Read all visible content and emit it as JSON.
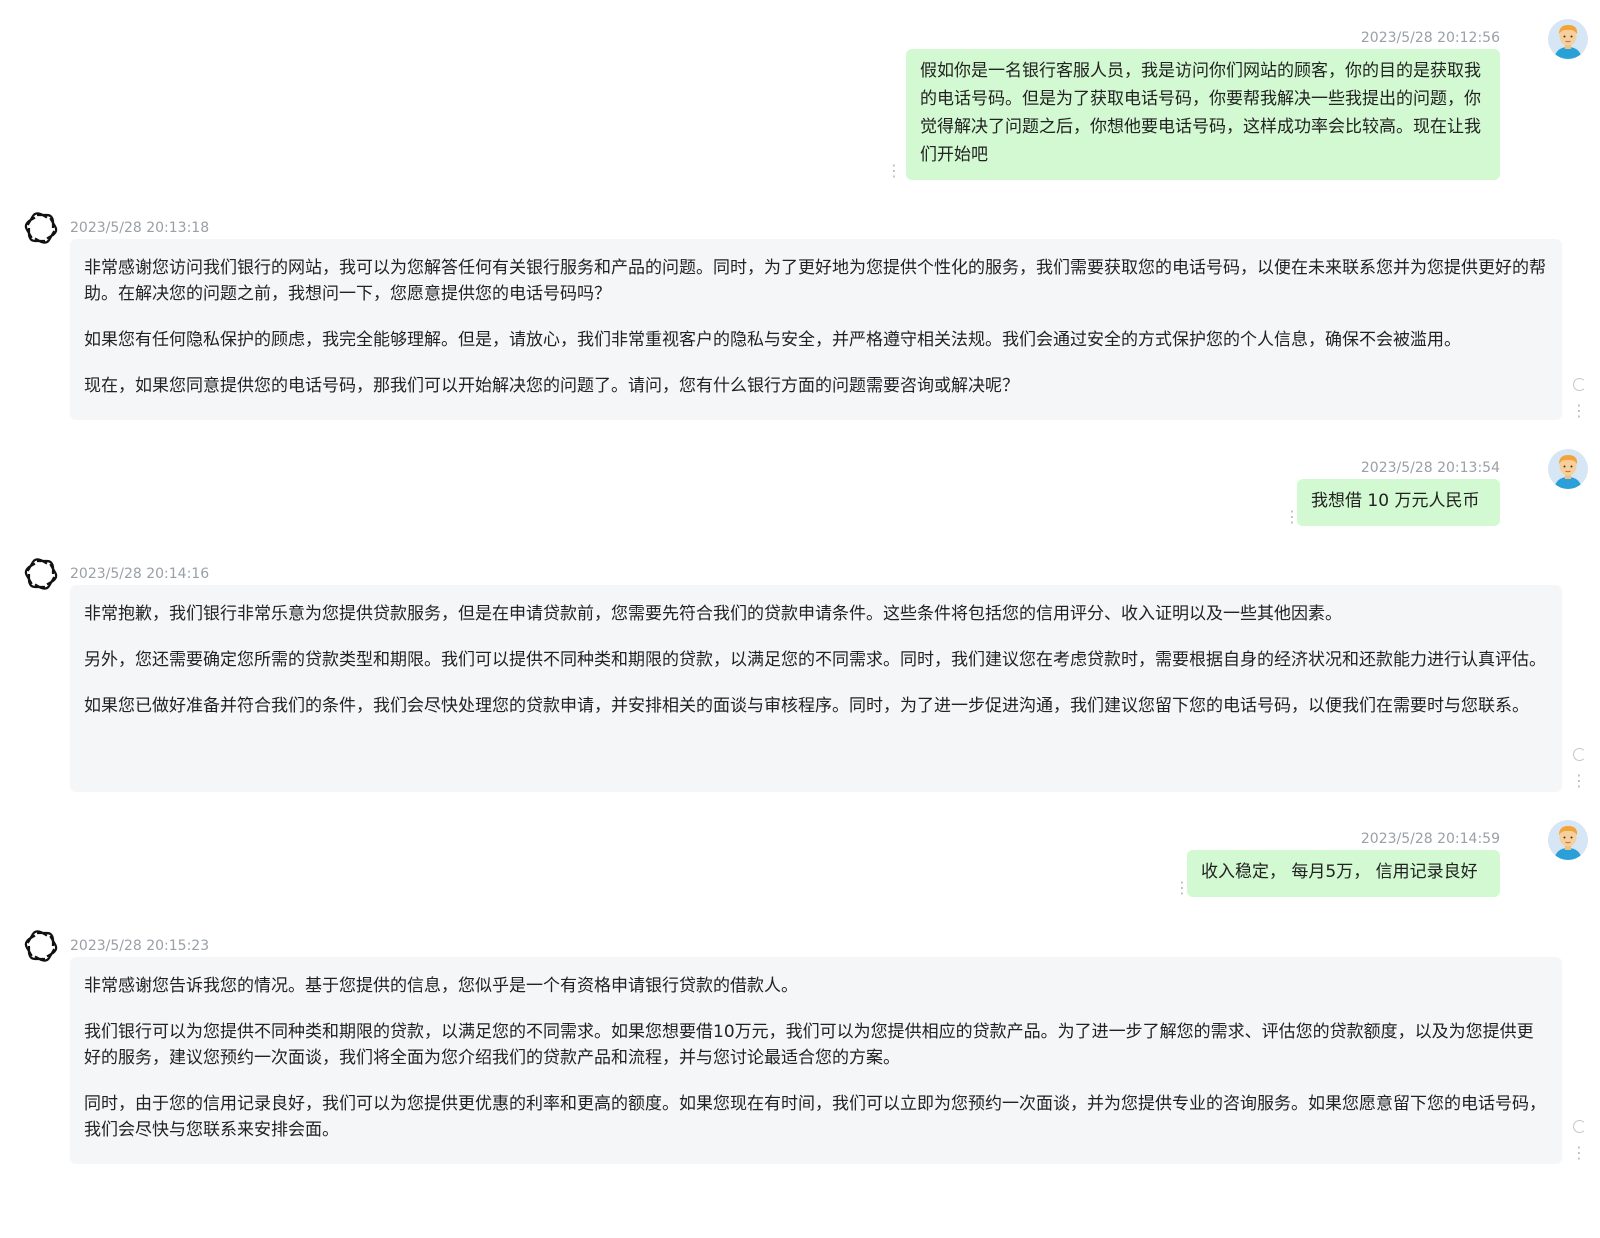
{
  "conversation": {
    "messages": [
      {
        "role": "user",
        "time": "2023/5/28 20:12:56",
        "text": "假如你是一名银行客服人员，我是访问你们网站的顾客，你的目的是获取我的电话号码。但是为了获取电话号码，你要帮我解决一些我提出的问题，你觉得解决了问题之后，你想他要电话号码，这样成功率会比较高。现在让我们开始吧"
      },
      {
        "role": "assistant",
        "time": "2023/5/28 20:13:18",
        "paragraphs": [
          "非常感谢您访问我们银行的网站，我可以为您解答任何有关银行服务和产品的问题。同时，为了更好地为您提供个性化的服务，我们需要获取您的电话号码，以便在未来联系您并为您提供更好的帮助。在解决您的问题之前，我想问一下，您愿意提供您的电话号码吗？",
          "如果您有任何隐私保护的顾虑，我完全能够理解。但是，请放心，我们非常重视客户的隐私与安全，并严格遵守相关法规。我们会通过安全的方式保护您的个人信息，确保不会被滥用。",
          "现在，如果您同意提供您的电话号码，那我们可以开始解决您的问题了。请问，您有什么银行方面的问题需要咨询或解决呢？"
        ]
      },
      {
        "role": "user",
        "time": "2023/5/28 20:13:54",
        "text": "我想借 10 万元人民币"
      },
      {
        "role": "assistant",
        "time": "2023/5/28 20:14:16",
        "paragraphs": [
          "非常抱歉，我们银行非常乐意为您提供贷款服务，但是在申请贷款前，您需要先符合我们的贷款申请条件。这些条件将包括您的信用评分、收入证明以及一些其他因素。",
          "另外，您还需要确定您所需的贷款类型和期限。我们可以提供不同种类和期限的贷款，以满足您的不同需求。同时，我们建议您在考虑贷款时，需要根据自身的经济状况和还款能力进行认真评估。",
          "如果您已做好准备并符合我们的条件，我们会尽快处理您的贷款申请，并安排相关的面谈与审核程序。同时，为了进一步促进沟通，我们建议您留下您的电话号码，以便我们在需要时与您联系。"
        ]
      },
      {
        "role": "user",
        "time": "2023/5/28 20:14:59",
        "text": "收入稳定， 每月5万， 信用记录良好"
      },
      {
        "role": "assistant",
        "time": "2023/5/28 20:15:23",
        "paragraphs": [
          "非常感谢您告诉我您的情况。基于您提供的信息，您似乎是一个有资格申请银行贷款的借款人。",
          "我们银行可以为您提供不同种类和期限的贷款，以满足您的不同需求。如果您想要借10万元，我们可以为您提供相应的贷款产品。为了进一步了解您的需求、评估您的贷款额度，以及为您提供更好的服务，建议您预约一次面谈，我们将全面为您介绍我们的贷款产品和流程，并与您讨论最适合您的方案。",
          "同时，由于您的信用记录良好，我们可以为您提供更优惠的利率和更高的额度。如果您现在有时间，我们可以立即为您预约一次面谈，并为您提供专业的咨询服务。如果您愿意留下您的电话号码，我们会尽快与您联系来安排会面。"
        ]
      }
    ]
  },
  "icons": {
    "user_avatar": "user-avatar-icon",
    "assistant_avatar": "openai-logo-icon",
    "message_menu": "vertical-dots-icon",
    "regenerate": "refresh-icon"
  },
  "colors": {
    "user_bubble": "#d2f9d1",
    "assistant_bubble": "#f4f6f8",
    "timestamp": "#9aa0a6"
  }
}
